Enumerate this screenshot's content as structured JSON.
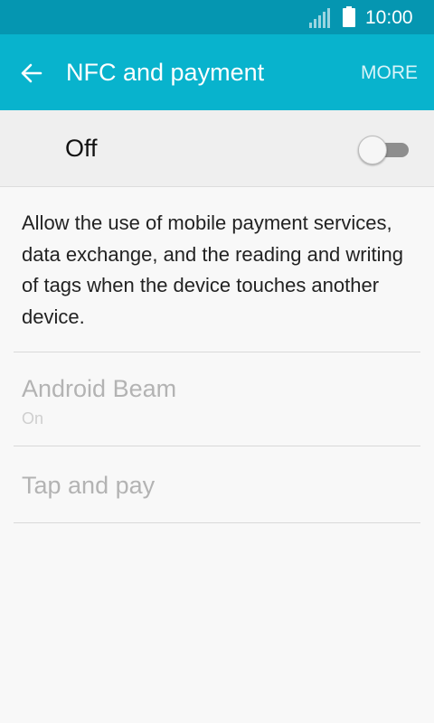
{
  "status_bar": {
    "time": "10:00",
    "icons": [
      "signal-icon",
      "battery-icon"
    ]
  },
  "app_bar": {
    "back_icon": "arrow-left-icon",
    "title": "NFC and payment",
    "more_label": "MORE",
    "colors": {
      "status_bar": "#0596b1",
      "app_bar": "#08b3cd"
    }
  },
  "master_switch": {
    "label": "Off",
    "state": "off"
  },
  "description": "Allow the use of mobile payment services, data exchange, and the reading and writing of tags when the device touches another device.",
  "items": [
    {
      "title": "Android Beam",
      "subtitle": "On",
      "enabled": false
    },
    {
      "title": "Tap and pay",
      "enabled": false
    }
  ]
}
